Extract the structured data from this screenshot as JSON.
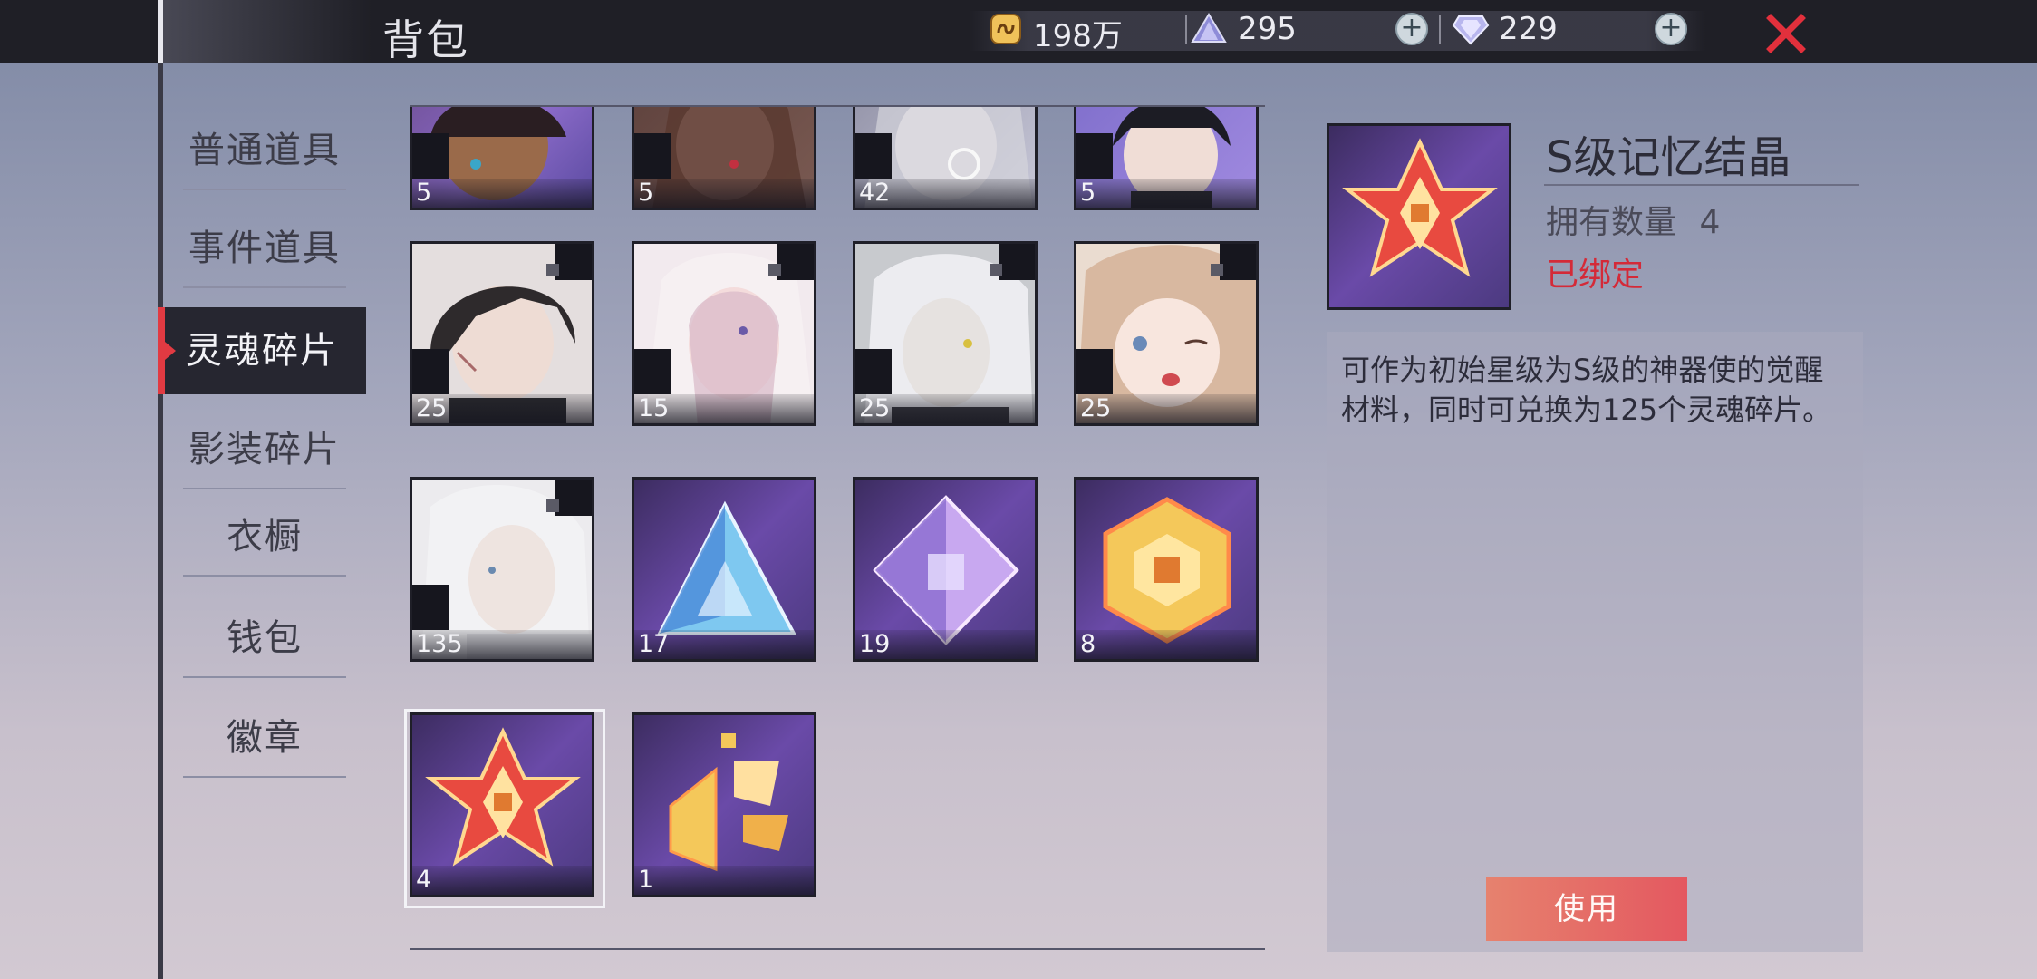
{
  "header": {
    "title": "背包",
    "currencies": [
      {
        "icon": "gold-coin-icon",
        "value": "198万"
      },
      {
        "icon": "crystal-pyramid-icon",
        "value": "295"
      },
      {
        "icon": "diamond-icon",
        "value": "229"
      }
    ]
  },
  "sidebar": {
    "items": [
      {
        "label": "普通道具"
      },
      {
        "label": "事件道具"
      },
      {
        "label": "灵魂碎片",
        "active": true
      },
      {
        "label": "影装碎片"
      },
      {
        "label": "衣橱"
      },
      {
        "label": "钱包"
      },
      {
        "label": "徽章"
      }
    ]
  },
  "inventory": {
    "items": [
      {
        "kind": "portrait-dark-skin-girl",
        "count": "5"
      },
      {
        "kind": "portrait-brown-hair-girl",
        "count": "5"
      },
      {
        "kind": "portrait-white-hair-glasses",
        "count": "42"
      },
      {
        "kind": "portrait-black-hair-boy",
        "count": "5"
      },
      {
        "kind": "portrait-dark-hair-scar-man",
        "count": "25"
      },
      {
        "kind": "portrait-pink-hair-veil-girl",
        "count": "15"
      },
      {
        "kind": "portrait-white-hair-man",
        "count": "25"
      },
      {
        "kind": "portrait-blonde-girl-wink",
        "count": "25"
      },
      {
        "kind": "portrait-silver-hair-old-man",
        "count": "135"
      },
      {
        "kind": "blue-pyramid-crystal",
        "count": "17"
      },
      {
        "kind": "purple-octahedron-crystal",
        "count": "19"
      },
      {
        "kind": "gold-hexagon-crystal",
        "count": "8"
      },
      {
        "kind": "red-star-crystal",
        "count": "4",
        "selected": true
      },
      {
        "kind": "gold-fragment-crystal",
        "count": "1"
      }
    ]
  },
  "detail": {
    "name": "S级记忆结晶",
    "owned_label": "拥有数量",
    "owned_count": "4",
    "bound_label": "已绑定",
    "description": "可作为初始星级为S级的神器使的觉醒材料，同时可兑换为125个灵魂碎片。",
    "use_button": "使用"
  },
  "colors": {
    "accent_red": "#e13a42",
    "use_button": "#e46a66",
    "bound_text": "#d42a38"
  }
}
